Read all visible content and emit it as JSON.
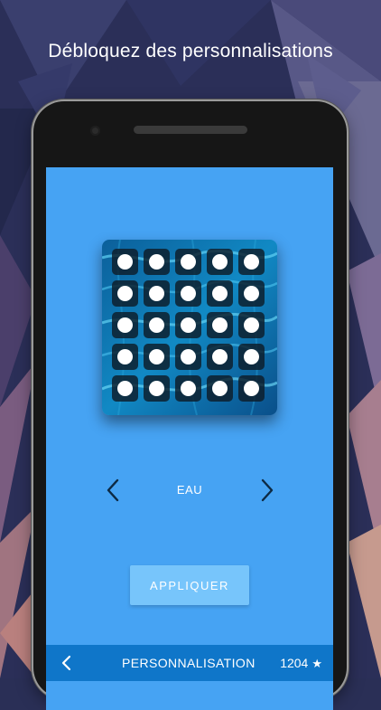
{
  "headline": "Débloquez des personnalisations",
  "theme": {
    "name": "EAU",
    "board_rows": 5,
    "board_cols": 5
  },
  "actions": {
    "apply_label": "APPLIQUER",
    "prev_icon": "chevron-left-icon",
    "next_icon": "chevron-right-icon"
  },
  "bottom_bar": {
    "title": "PERSONNALISATION",
    "score": "1204",
    "score_icon": "star-icon",
    "back_icon": "chevron-left-icon"
  },
  "colors": {
    "screen_bg": "#46a3f3",
    "bottom_bar": "#0f76c9",
    "apply_button": "#77c5fb"
  }
}
